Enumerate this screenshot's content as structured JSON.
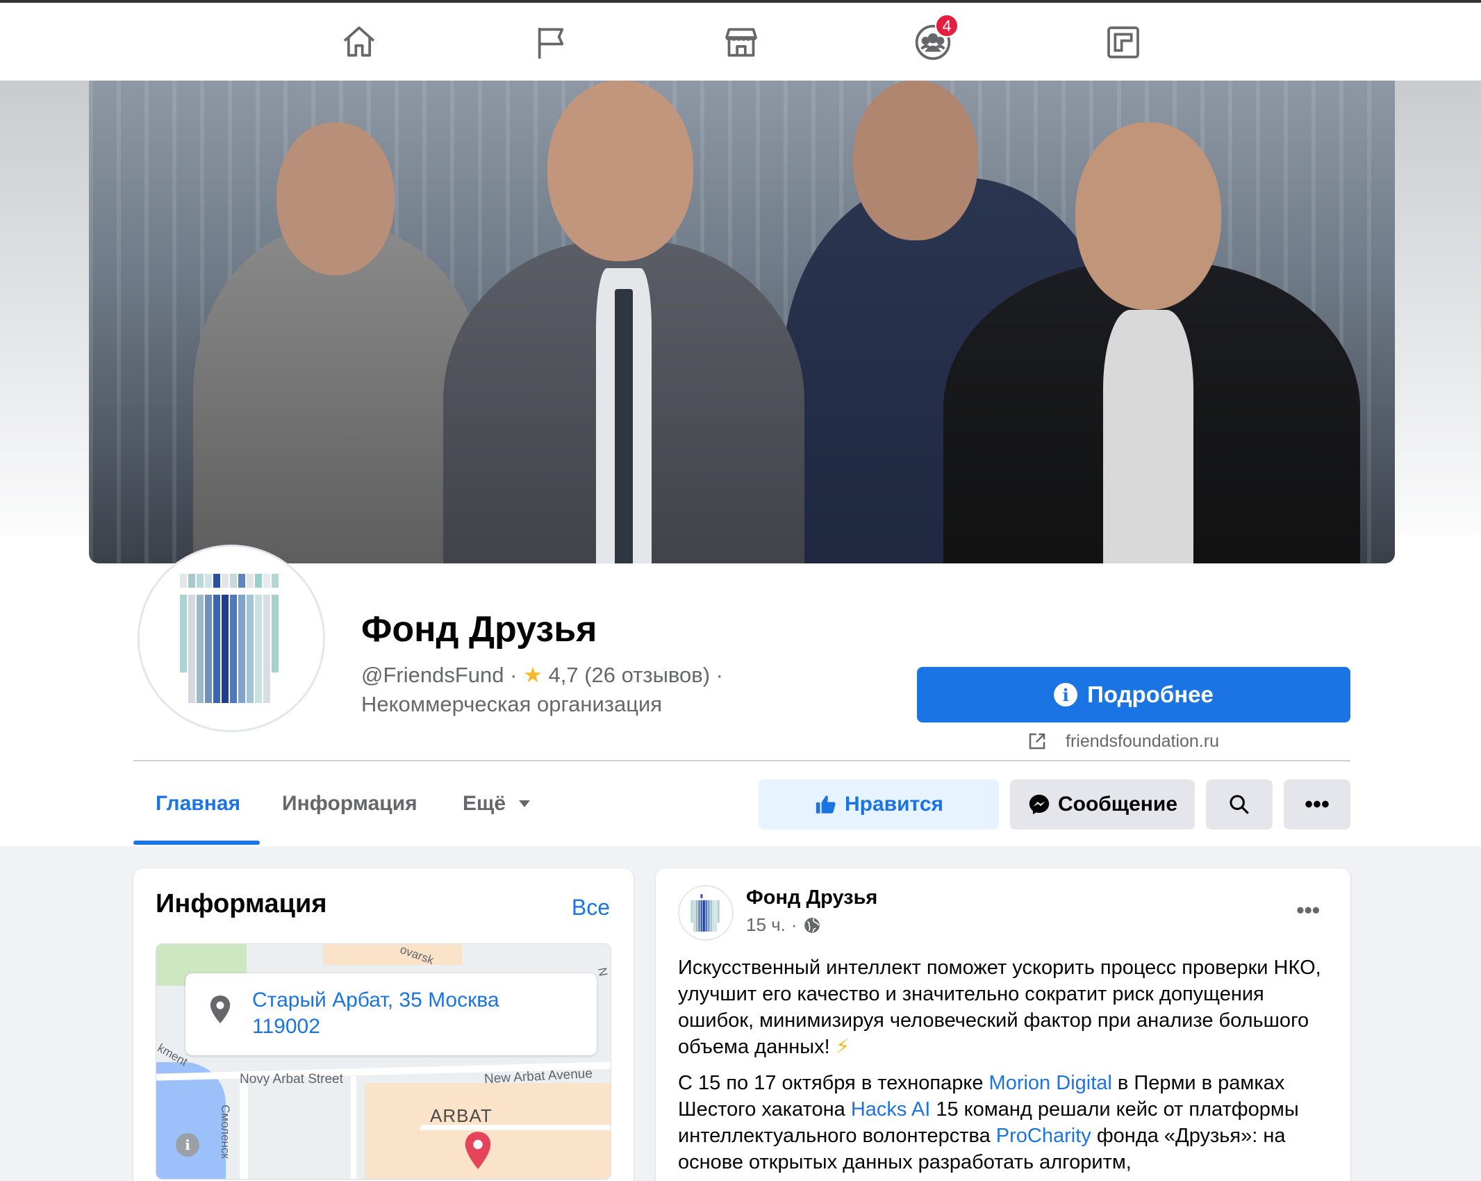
{
  "nav": {
    "notifications_badge": "4",
    "icons": [
      "home-icon",
      "flag-icon",
      "marketplace-icon",
      "groups-icon",
      "gaming-icon"
    ]
  },
  "page": {
    "name": "Фонд Друзья",
    "handle": "@FriendsFund",
    "rating": "4,7 (26 отзывов)",
    "category": "Некоммерческая организация",
    "more_button": "Подробнее",
    "website": "friendsfoundation.ru"
  },
  "tabs": [
    {
      "label": "Главная",
      "active": true
    },
    {
      "label": "Информация",
      "active": false
    },
    {
      "label": "Ещё",
      "active": false
    }
  ],
  "actions": {
    "like": "Нравится",
    "message": "Сообщение"
  },
  "info_card": {
    "title": "Информация",
    "see_all": "Все",
    "address_line1": "Старый Арбат, 35 Москва",
    "address_line2": "119002",
    "map_labels": {
      "novy_arbat": "Novy Arbat Street",
      "new_arbat": "New Arbat Avenue",
      "arbat": "ARBAT",
      "smolensk": "Смоленск",
      "ment": "kment",
      "ovarsk": "ovarsk",
      "n": "N"
    }
  },
  "post": {
    "author": "Фонд Друзья",
    "time": "15 ч.",
    "paragraph1": "Искусственный интеллект поможет ускорить процесс проверки НКО, улучшит его качество и значительно сократит риск допущения ошибок, минимизируя человеческий фактор при анализе большого объема данных!",
    "p2_a": "С 15 по 17 октября в технопарке ",
    "p2_link1": "Morion Digital",
    "p2_b": " в Перми в рамках Шестого хакатона ",
    "p2_link2": "Hacks AI",
    "p2_c": " 15 команд решали кейс от платформы интеллектуального волонтерства ",
    "p2_link3": "ProCharity",
    "p2_d": " фонда «Друзья»: на основе открытых данных разработать алгоритм,"
  },
  "colors": {
    "accent": "#1b74e4",
    "badge": "#e41e3f",
    "background": "#f0f2f5"
  }
}
